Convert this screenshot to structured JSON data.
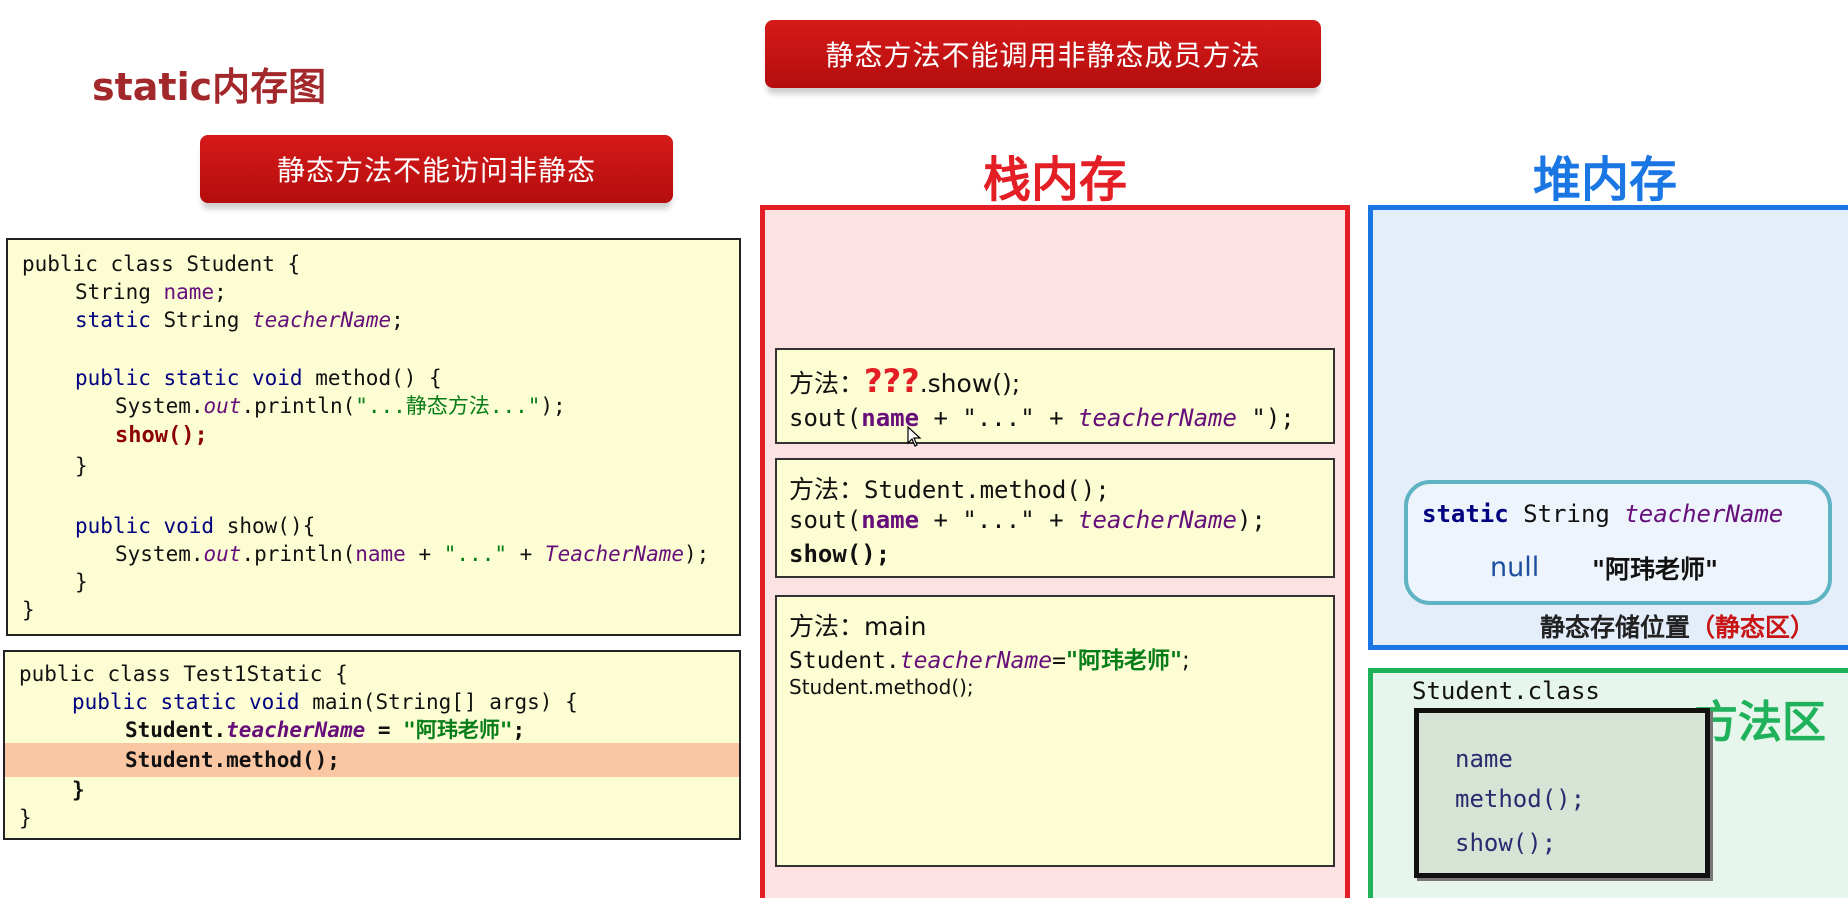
{
  "page_title": "static内存图",
  "banners": {
    "top": "静态方法不能调用非静态成员方法",
    "left": "静态方法不能访问非静态"
  },
  "columns": {
    "stack": "栈内存",
    "heap": "堆内存",
    "method_area": "方法区"
  },
  "student_code": {
    "l1": "public class Student {",
    "l2_type": "String",
    "l2_field": "name",
    "l3_mod": "static",
    "l3_type": "String",
    "l3_field": "teacherName",
    "l5_mods": "public static void",
    "l5_rest": "method() {",
    "l6_pre": "System.",
    "l6_out": "out",
    "l6_mid": ".println(",
    "l6_str": "\"...静态方法...\"",
    "l6_end": ");",
    "l7": "show();",
    "l8": "}",
    "l10_mods": "public void",
    "l10_rest": "show(){",
    "l11_pre": "System.",
    "l11_out": "out",
    "l11_mid": ".println(",
    "l11_name": "name",
    "l11_plus1": " + ",
    "l11_str": "\"...\"",
    "l11_plus2": " + ",
    "l11_field": "TeacherName",
    "l11_end": ");",
    "l12": "}",
    "l13": "}"
  },
  "test_code": {
    "l1": "public class Test1Static {",
    "l2_mods": "public static void",
    "l2_rest": "main(String[] args) {",
    "l3_cls": "Student.",
    "l3_field": "teacherName",
    "l3_eq": " = ",
    "l3_str": "\"阿玮老师\"",
    "l3_end": ";",
    "l4": "Student.method();",
    "l5": "}",
    "l6": "}"
  },
  "stack_frames": {
    "show": {
      "label": "方法：",
      "qmarks": "???",
      "call": ".show();",
      "sout_pre": "sout(",
      "sout_name": "name",
      "sout_mid": " + \"...\" + ",
      "sout_field": "teacherName",
      "sout_end": " \");"
    },
    "method": {
      "label": "方法：",
      "call": "Student.method();",
      "sout_pre": "sout(",
      "sout_name": "name",
      "sout_mid": " + \"...\" + ",
      "sout_field": "teacherName",
      "sout_end": ");",
      "show": "show();"
    },
    "main": {
      "label": "方法：main",
      "l2_cls": "Student.",
      "l2_field": "teacherName",
      "l2_eq": "=",
      "l2_str": "\"阿玮老师\"",
      "l2_end": ";",
      "l3": "Student.method();"
    }
  },
  "heap": {
    "static_decl_mod": "static",
    "static_decl_type": "String",
    "static_decl_field": "teacherName",
    "value_old": "null",
    "value_new": "\"阿玮老师\"",
    "static_location": "静态存储位置",
    "static_zone": "（静态区）"
  },
  "method_area": {
    "class_name": "Student.class",
    "members": [
      "name",
      "method();",
      "show();"
    ]
  },
  "colors": {
    "stack_border": "#e31e24",
    "heap_border": "#1976e3",
    "method_border": "#1fb25a",
    "banner": "#c81414"
  }
}
